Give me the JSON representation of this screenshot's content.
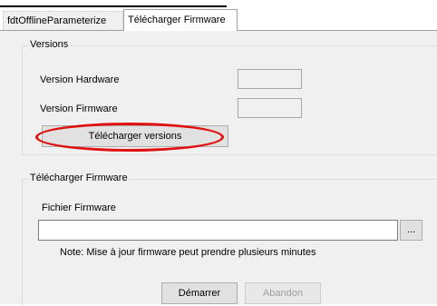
{
  "tabs": [
    {
      "label": "fdtOfflineParameterize",
      "active": false
    },
    {
      "label": "Télécharger Firmware",
      "active": true
    }
  ],
  "versions_group": {
    "title": "Versions",
    "hardware_label": "Version Hardware",
    "hardware_value": "",
    "firmware_label": "Version Firmware",
    "firmware_value": "",
    "download_button": "Télécharger versions"
  },
  "firmware_group": {
    "title": "Télécharger Firmware",
    "file_label": "Fichier Firmware",
    "file_value": "",
    "browse_button": "...",
    "note": "Note: Mise à jour firmware peut prendre plusieurs minutes",
    "start_button": "Démarrer",
    "abort_button": "Abandon"
  },
  "colors": {
    "highlight": "#e01010",
    "panel_bg": "#f0f0f0"
  }
}
